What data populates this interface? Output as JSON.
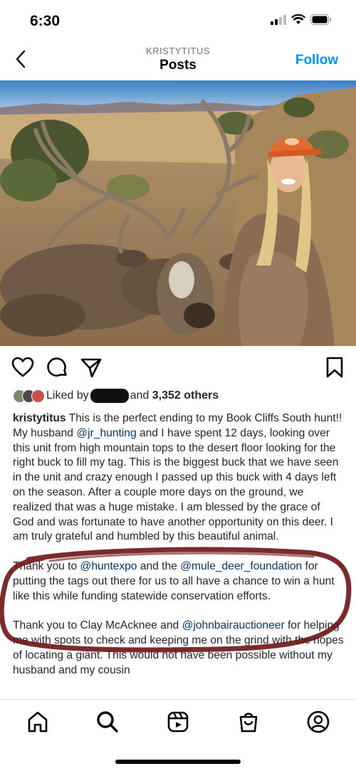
{
  "status_bar": {
    "time": "6:30"
  },
  "header": {
    "username": "KRISTYTITUS",
    "title": "Posts",
    "follow_label": "Follow"
  },
  "likes": {
    "prefix": "Liked by",
    "suffix": "and",
    "count": "3,352 others"
  },
  "caption": {
    "username": "kristytitus",
    "p1_a": " This is the perfect ending to my Book Cliffs South hunt!! My husband ",
    "p1_mention": "@jr_hunting",
    "p1_b": " and I have spent 12 days, looking over this unit from high mountain tops to the desert floor looking for the right buck to fill my tag. This is the biggest buck that we have seen in the unit and crazy enough I passed up this buck with 4 days left on the season. After a couple more days on the ground, we realized that was a huge mistake. I am blessed by the grace of God and was fortunate to have another opportunity on this deer. I am truly grateful and humbled by this beautiful animal.",
    "p2_a": "Thank you to ",
    "p2_m1": "@huntexpo",
    "p2_b": " and the ",
    "p2_m2": "@mule_deer_foundation",
    "p2_c": " for putting the tags out there for us to all have a chance to win a hunt like this while funding statewide conservation efforts.",
    "p3_a": "Thank you to Clay McAcknee and ",
    "p3_m1": "@johnbairauctioneer",
    "p3_b": " for helping me with spots to check and keeping me on the grind with the hopes of locating a giant. This would not have been possible without my husband and my cousin"
  },
  "colors": {
    "link": "#0095f6",
    "mention": "#00376b",
    "marker": "#6b1414"
  }
}
